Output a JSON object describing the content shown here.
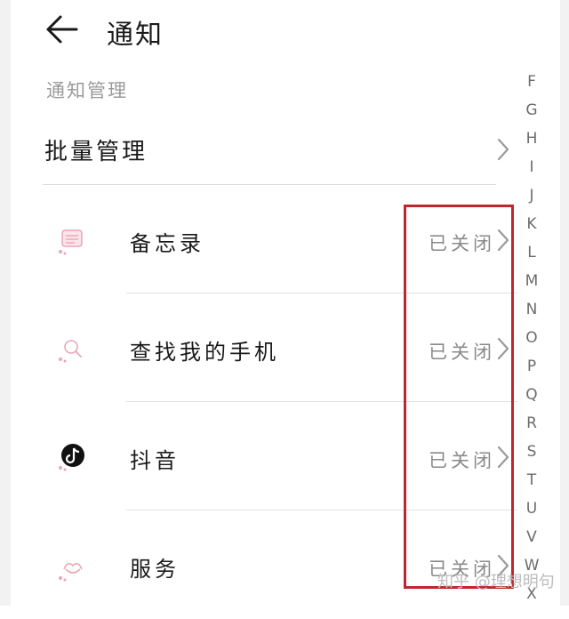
{
  "header": {
    "title": "通知",
    "back_icon": "arrow-left-icon"
  },
  "section_label": "通知管理",
  "batch": {
    "label": "批量管理"
  },
  "apps": [
    {
      "name": "备忘录",
      "status": "已关闭",
      "icon": "memo-icon",
      "icon_color": "#e9a7b8"
    },
    {
      "name": "查找我的手机",
      "status": "已关闭",
      "icon": "find-phone-icon",
      "icon_color": "#e9a7b8"
    },
    {
      "name": "抖音",
      "status": "已关闭",
      "icon": "tiktok-icon",
      "icon_color": "#111111"
    },
    {
      "name": "服务",
      "status": "已关闭",
      "icon": "service-icon",
      "icon_color": "#e9a7b8"
    }
  ],
  "alpha_index": [
    "F",
    "G",
    "H",
    "I",
    "J",
    "K",
    "L",
    "M",
    "N",
    "O",
    "P",
    "Q",
    "R",
    "S",
    "T",
    "U",
    "V",
    "W",
    "X"
  ],
  "watermark": "知乎 @理想明句",
  "colors": {
    "highlight": "#c0262c",
    "status_text": "#8a8a8a",
    "section_label": "#9a9a9a"
  }
}
